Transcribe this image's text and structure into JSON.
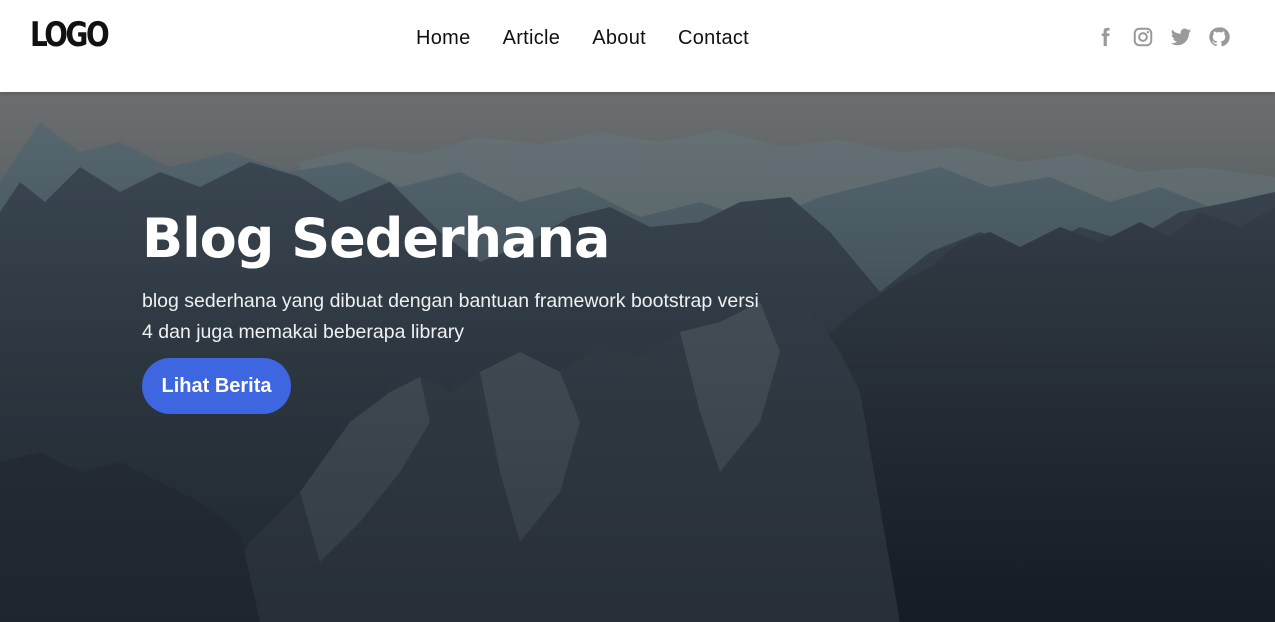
{
  "header": {
    "logo": "LOGO",
    "nav": [
      {
        "label": "Home"
      },
      {
        "label": "Article"
      },
      {
        "label": "About"
      },
      {
        "label": "Contact"
      }
    ],
    "social": [
      {
        "icon": "facebook-icon"
      },
      {
        "icon": "instagram-icon"
      },
      {
        "icon": "twitter-icon"
      },
      {
        "icon": "github-icon"
      }
    ],
    "icon_color": "#9a9a9a"
  },
  "hero": {
    "title": "Blog Sederhana",
    "description": "blog sederhana yang dibuat dengan bantuan framework bootstrap versi 4 dan juga memakai beberapa library",
    "button_label": "Lihat Berita",
    "button_color": "#3d66e0"
  }
}
